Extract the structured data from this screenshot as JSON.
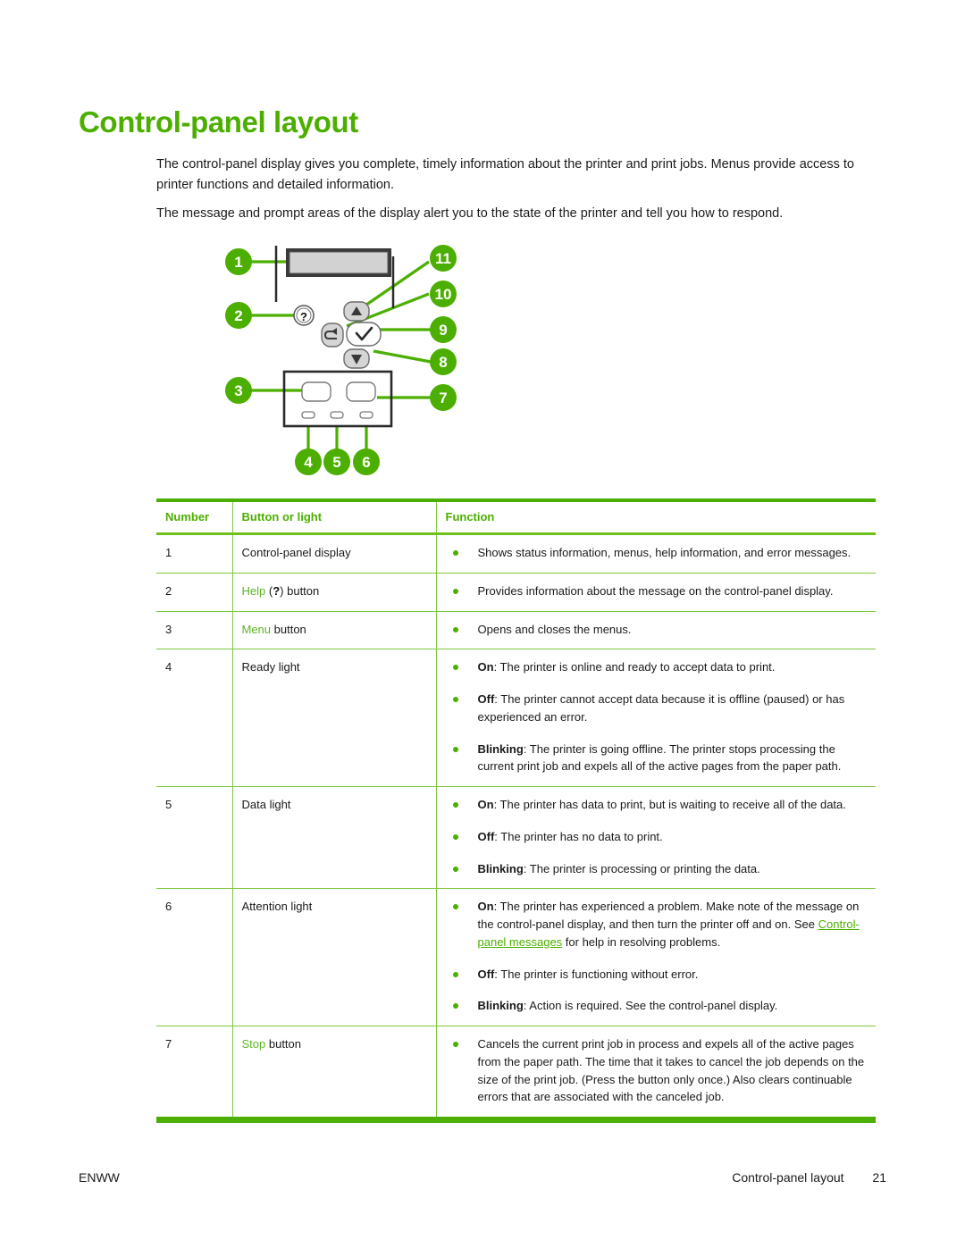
{
  "heading": "Control-panel layout",
  "intro": {
    "paragraph1": "The control-panel display gives you complete, timely information about the printer and print jobs. Menus provide access to printer functions and detailed information.",
    "paragraph2": "The message and prompt areas of the display alert you to the state of the printer and tell you how to respond."
  },
  "diagram": {
    "name": "control-panel-callout-diagram",
    "callouts": [
      "1",
      "2",
      "3",
      "4",
      "5",
      "6",
      "7",
      "8",
      "9",
      "10",
      "11"
    ],
    "help_glyph": "?",
    "accent_color": "#4CAF00"
  },
  "table": {
    "headers": {
      "number": "Number",
      "button": "Button or light",
      "function": "Function"
    },
    "rows": [
      {
        "number": "1",
        "button_plain": "Control-panel display",
        "bullets": [
          {
            "lead": "",
            "text": "Shows status information, menus, help information, and error messages."
          }
        ]
      },
      {
        "number": "2",
        "button_green": "Help",
        "button_glyph": "?",
        "button_suffix": " button",
        "bullets": [
          {
            "lead": "",
            "text": "Provides information about the message on the control-panel display."
          }
        ]
      },
      {
        "number": "3",
        "button_green": "Menu",
        "button_suffix": " button",
        "bullets": [
          {
            "lead": "",
            "text": "Opens and closes the menus."
          }
        ]
      },
      {
        "number": "4",
        "button_plain": "Ready light",
        "bullets": [
          {
            "lead": "On",
            "text": ": The printer is online and ready to accept data to print."
          },
          {
            "lead": "Off",
            "text": ": The printer cannot accept data because it is offline (paused) or has experienced an error."
          },
          {
            "lead": "Blinking",
            "text": ": The printer is going offline. The printer stops processing the current print job and expels all of the active pages from the paper path."
          }
        ]
      },
      {
        "number": "5",
        "button_plain": "Data light",
        "bullets": [
          {
            "lead": "On",
            "text": ": The printer has data to print, but is waiting to receive all of the data."
          },
          {
            "lead": "Off",
            "text": ": The printer has no data to print."
          },
          {
            "lead": "Blinking",
            "text": ": The printer is processing or printing the data."
          }
        ]
      },
      {
        "number": "6",
        "button_plain": "Attention light",
        "bullets": [
          {
            "lead": "On",
            "text": ": The printer has experienced a problem. Make note of the message on the control-panel display, and then turn the printer off and on. See ",
            "link": "Control-panel messages",
            "text_after": " for help in resolving problems."
          },
          {
            "lead": "Off",
            "text": ": The printer is functioning without error."
          },
          {
            "lead": "Blinking",
            "text": ": Action is required. See the control-panel display."
          }
        ]
      },
      {
        "number": "7",
        "button_green": "Stop",
        "button_suffix": " button",
        "bullets": [
          {
            "lead": "",
            "text": "Cancels the current print job in process and expels all of the active pages from the paper path. The time that it takes to cancel the job depends on the size of the print job. (Press the button only once.) Also clears continuable errors that are associated with the canceled job."
          }
        ]
      }
    ]
  },
  "footer": {
    "left": "ENWW",
    "section": "Control-panel layout",
    "page": "21"
  }
}
